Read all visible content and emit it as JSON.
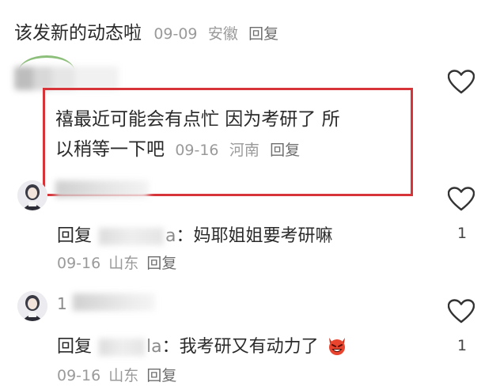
{
  "comments": [
    {
      "text": "该发新的动态啦",
      "date": "09-09",
      "location": "安徽",
      "reply_label": "回复"
    },
    {
      "text_line1": "禧最近可能会有点忙 因为考研了 所",
      "text_line2": "以稍等一下吧",
      "date": "09-16",
      "location": "河南",
      "reply_label": "回复"
    }
  ],
  "replies": [
    {
      "prefix": "回复",
      "name_visible": "a",
      "separator": "：",
      "text": "妈耶姐姐要考研嘛",
      "date": "09-16",
      "location": "山东",
      "reply_label": "回复",
      "like_count": "1"
    },
    {
      "name_visible_start": "1",
      "prefix": "回复",
      "name_visible": "la",
      "separator": "：",
      "text": "我考研又有动力了",
      "date": "09-16",
      "location": "山东",
      "reply_label": "回复",
      "like_count": "1",
      "emoji": "devil-emoji"
    }
  ],
  "colors": {
    "highlight_box": "#d7343a",
    "meta_text": "#9a9a9a",
    "emoji": "#e8442e"
  }
}
